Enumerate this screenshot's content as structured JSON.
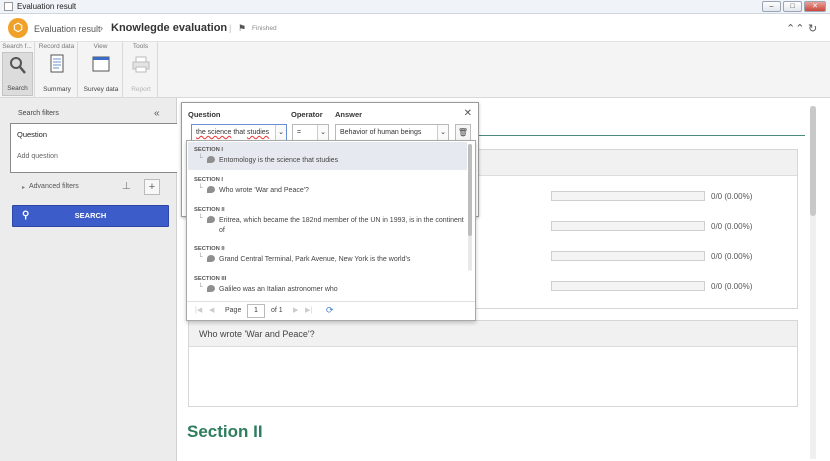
{
  "window": {
    "title": "Evaluation result",
    "buttons": [
      "–",
      "□",
      "✕"
    ]
  },
  "header": {
    "breadcrumb_parent": "Evaluation result",
    "breadcrumb_current": "Knowlegde evaluation",
    "status": "Finished",
    "actions": [
      "⌃⌃",
      "↻"
    ]
  },
  "ribbon": {
    "groups": [
      {
        "title": "Search f...",
        "buttons": [
          {
            "label": "Search",
            "icon": "magnifier-icon",
            "state": "active"
          }
        ]
      },
      {
        "title": "Record data",
        "buttons": [
          {
            "label": "Summary",
            "icon": "document-icon",
            "state": "normal"
          }
        ]
      },
      {
        "title": "View",
        "buttons": [
          {
            "label": "Survey data",
            "icon": "window-icon",
            "state": "normal"
          }
        ]
      },
      {
        "title": "Tools",
        "buttons": [
          {
            "label": "Report",
            "icon": "printer-icon",
            "state": "disabled"
          }
        ]
      }
    ]
  },
  "filters": {
    "title": "Search filters",
    "question_label": "Question",
    "add_question": "Add question",
    "advanced": "Advanced filters",
    "search_button": "SEARCH"
  },
  "popup": {
    "question_label": "Question",
    "operator_label": "Operator",
    "answer_label": "Answer",
    "question_value_pre": "the science",
    "question_value_mid": " that ",
    "question_value_post": "studies",
    "operator_value": "=",
    "answer_value": "Behavior of human beings"
  },
  "dropdown": {
    "items": [
      {
        "section": "SECTION I",
        "text": "Entomology is the science that studies",
        "selected": true
      },
      {
        "section": "SECTION I",
        "text": "Who wrote 'War and Peace'?",
        "selected": false
      },
      {
        "section": "SECTION II",
        "text": "Eritrea, which became the 182nd member of the UN in 1993, is in the continent of",
        "selected": false
      },
      {
        "section": "SECTION II",
        "text": "Grand Central Terminal, Park Avenue, New York is the world's",
        "selected": false
      },
      {
        "section": "SECTION III",
        "text": "Galileo was an Italian astronomer who",
        "selected": false
      }
    ],
    "pager": {
      "page_label": "Page",
      "page_value": "1",
      "of_label": "of 1"
    }
  },
  "main": {
    "bars": [
      "0/0 (0.00%)",
      "0/0 (0.00%)",
      "0/0 (0.00%)",
      "0/0 (0.00%)"
    ],
    "question_card_title": "Who wrote 'War and Peace'?",
    "section_title": "Section II"
  },
  "colors": {
    "accent_blue": "#3b5cc9",
    "section_green": "#2e7d5e",
    "logo_orange": "#f0a12a"
  }
}
